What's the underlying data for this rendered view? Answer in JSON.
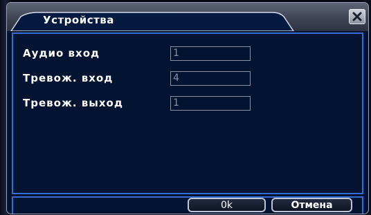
{
  "dialog": {
    "title": "Устройства",
    "close_icon": "close-icon"
  },
  "fields": [
    {
      "label": "Аудио вход",
      "value": "1"
    },
    {
      "label": "Тревож.  вход",
      "value": "4"
    },
    {
      "label": "Тревож.  выход",
      "value": "1"
    }
  ],
  "buttons": {
    "ok": "0k",
    "cancel": "Отмена"
  },
  "colors": {
    "accent": "#2f6fd6",
    "background": "#03132f",
    "title_bar": "#4a5061"
  }
}
